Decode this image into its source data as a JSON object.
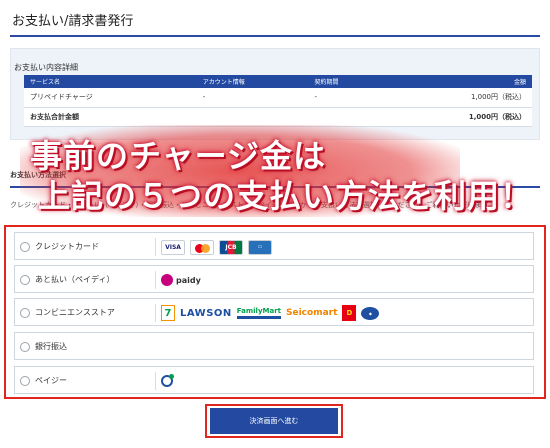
{
  "page": {
    "title": "お支払い/請求書発行"
  },
  "detail": {
    "heading": "お支払い内容詳細",
    "columns": [
      "サービス名",
      "アカウント情報",
      "契約期間",
      "金額"
    ],
    "rows": [
      {
        "service": "プリペイドチャージ",
        "account": "-",
        "period": "-",
        "amount": "1,000円（税込）"
      }
    ],
    "total": {
      "label": "お支払合計金額",
      "amount": "1,000円（税込）"
    }
  },
  "section": {
    "heading": "お支払い方法選択",
    "description": "クレジットカード・あと払い（ペイディ）・銀行振込・コンビニエンスストア・ペイジーの中からお支払い方法を選択してください。ご利用いただけます。"
  },
  "overlay": {
    "line1": "事前のチャージ金は",
    "line2": "上記の５つの支払い方法を利用！"
  },
  "methods": [
    {
      "label": "クレジットカード",
      "logos": [
        "VISA",
        "Mastercard",
        "JCB",
        "AMEX"
      ]
    },
    {
      "label": "あと払い（ペイディ）",
      "logos": [
        "paidy"
      ]
    },
    {
      "label": "コンビニエンスストア",
      "logos": [
        "7",
        "LAWSON",
        "FamilyMart",
        "Seicomart",
        "Daily",
        "MINISTOP"
      ]
    },
    {
      "label": "銀行振込",
      "logos": []
    },
    {
      "label": "ペイジー",
      "logos": [
        "Pay-easy"
      ]
    }
  ],
  "submit": {
    "label": "決済画面へ進む"
  },
  "colors": {
    "accent": "#234aa0",
    "highlight": "#e0261f"
  }
}
